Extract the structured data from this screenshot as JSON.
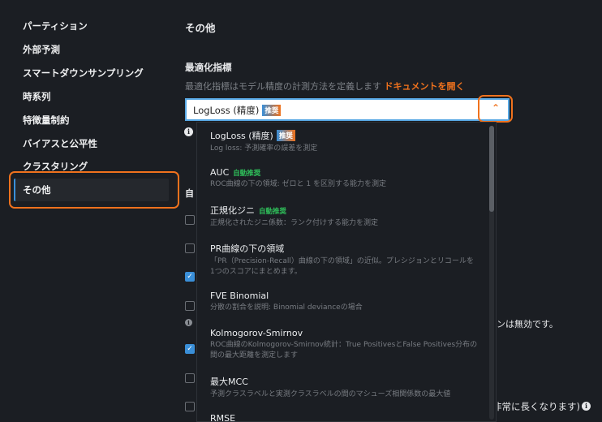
{
  "sidebar": {
    "items": [
      {
        "label": "パーティション"
      },
      {
        "label": "外部予測"
      },
      {
        "label": "スマートダウンサンプリング"
      },
      {
        "label": "時系列"
      },
      {
        "label": "特徴量制約"
      },
      {
        "label": "バイアスと公平性"
      },
      {
        "label": "クラスタリング"
      },
      {
        "label": "その他",
        "selected": true
      }
    ]
  },
  "main": {
    "title": "その他",
    "metric_label": "最適化指標",
    "metric_desc": "最適化指標はモデル精度の計測方法を定義します",
    "doc_link": "ドキュメントを開く",
    "selected_value": "LogLoss (精度)",
    "selected_badge": "推奨",
    "partial_heading": "自",
    "partial_text_1": "ンは無効です。",
    "partial_text_2": "非常に長くなります)"
  },
  "dropdown": {
    "options": [
      {
        "title": "LogLoss (精度)",
        "badge": "推奨",
        "desc": "Log loss: 予測確率の誤差を測定"
      },
      {
        "title": "AUC",
        "auto": "自動推奨",
        "desc": "ROC曲線の下の領域: ゼロと 1 を区別する能力を測定"
      },
      {
        "title": "正規化ジニ",
        "auto": "自動推奨",
        "desc": "正規化されたジニ係数：ランク付けする能力を測定"
      },
      {
        "title": "PR曲線の下の領域",
        "desc": "「PR（Precision-Recall）曲線の下の領域」の近似。プレシジョンとリコールを1つのスコアにまとめます。"
      },
      {
        "title": "FVE Binomial",
        "desc": "分散の割合を説明: Binomial devianceの場合"
      },
      {
        "title": "Kolmogorov-Smirnov",
        "desc": "ROC曲線のKolmogorov-Smirnov統計：True PositivesとFalse Positives分布の間の最大距離を測定します"
      },
      {
        "title": "最大MCC",
        "desc": "予測クラスラベルと実測クラスラベルの間のマシューズ相関係数の最大値"
      },
      {
        "title": "RMSE"
      }
    ]
  },
  "checkboxes": [
    false,
    false,
    true,
    false,
    true,
    false,
    false
  ],
  "colors": {
    "accent": "#f0721d",
    "blue": "#3a8fd8",
    "auto": "#2fbf5a"
  }
}
